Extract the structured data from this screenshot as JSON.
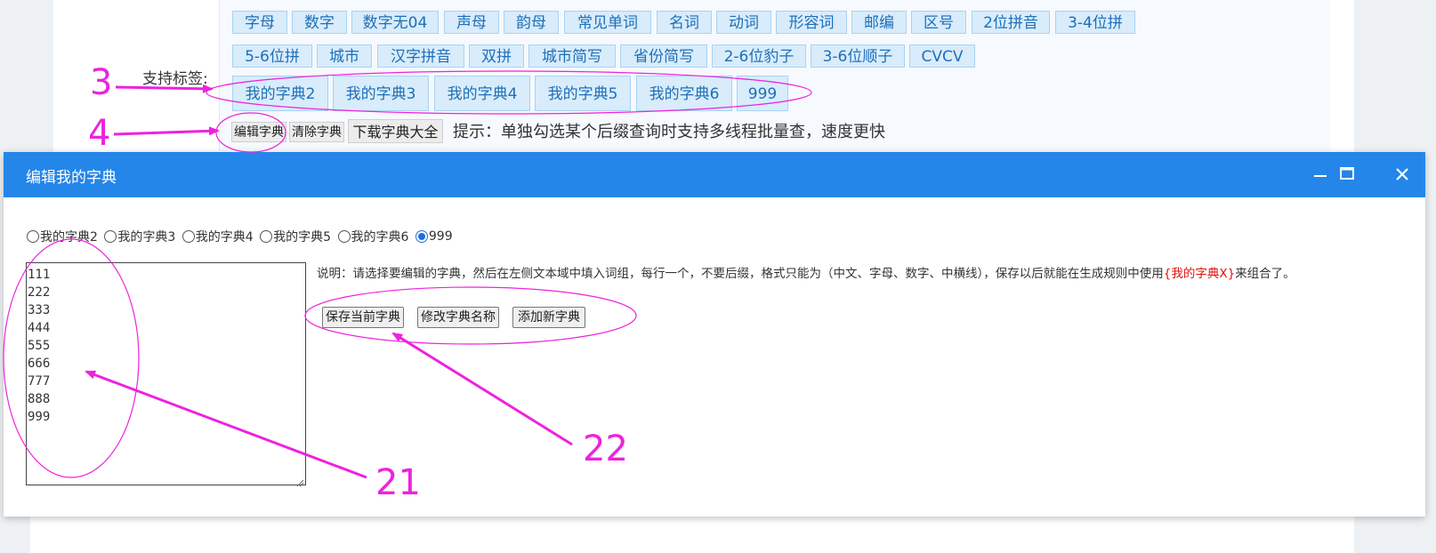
{
  "tags_row1": [
    "字母",
    "数字",
    "数字无04",
    "声母",
    "韵母",
    "常见单词",
    "名词",
    "动词",
    "形容词",
    "邮编",
    "区号",
    "2位拼音",
    "3-4位拼"
  ],
  "tags_row2": [
    "5-6位拼",
    "城市",
    "汉字拼音",
    "双拼",
    "城市简写",
    "省份简写",
    "2-6位豹子",
    "3-6位顺子",
    "CVCV"
  ],
  "tags_row3": [
    "我的字典2",
    "我的字典3",
    "我的字典4",
    "我的字典5",
    "我的字典6",
    "999"
  ],
  "support_label": "支持标签:",
  "buttons": {
    "edit": "编辑字典",
    "clear": "清除字典",
    "download": "下载字典大全"
  },
  "hint": "提示：单独勾选某个后缀查询时支持多线程批量查，速度更快",
  "dialog": {
    "title": "编辑我的字典",
    "radios": [
      {
        "label": "我的字典2",
        "checked": false
      },
      {
        "label": "我的字典3",
        "checked": false
      },
      {
        "label": "我的字典4",
        "checked": false
      },
      {
        "label": "我的字典5",
        "checked": false
      },
      {
        "label": "我的字典6",
        "checked": false
      },
      {
        "label": "999",
        "checked": true
      }
    ],
    "textarea_value": "111\n222\n333\n444\n555\n666\n777\n888\n999",
    "desc_prefix": "说明：请选择要编辑的字典，然后在左侧文本域中填入词组，每行一个，不要后缀，格式只能为（中文、字母、数字、中横线），保存以后就能在生成规则中使用",
    "desc_highlight": "{我的字典X}",
    "desc_suffix": "来组合了。",
    "save_btn": "保存当前字典",
    "rename_btn": "修改字典名称",
    "add_btn": "添加新字典"
  },
  "annotations": {
    "n3": "3",
    "n4": "4",
    "n21": "21",
    "n22": "22",
    "color": "#ee22dd"
  },
  "colors": {
    "titlebar": "#2486e9",
    "tag_bg": "#d8ecfb",
    "tag_text": "#1e6fb8"
  }
}
